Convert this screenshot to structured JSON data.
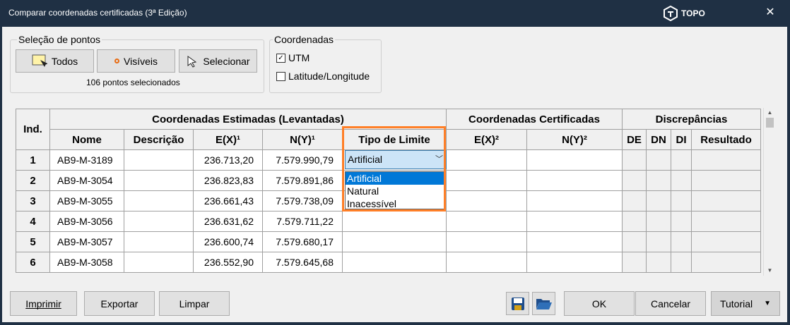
{
  "window": {
    "title": "Comparar coordenadas certificadas (3ª Edição)",
    "brand": "TOPO"
  },
  "selection": {
    "group_label": "Seleção de pontos",
    "todos": "Todos",
    "visiveis": "Visíveis",
    "selecionar": "Selecionar",
    "status": "106 pontos selecionados"
  },
  "coords": {
    "group_label": "Coordenadas",
    "utm": "UTM",
    "utm_checked": true,
    "latlon": "Latitude/Longitude",
    "latlon_checked": false
  },
  "grid": {
    "header_idx": "Ind.",
    "group_estimated": "Coordenadas Estimadas (Levantadas)",
    "group_certified": "Coordenadas Certificadas",
    "group_discrep": "Discrepâncias",
    "col_nome": "Nome",
    "col_descricao": "Descrição",
    "col_ex": "E(X)¹",
    "col_ny": "N(Y)¹",
    "col_tipo": "Tipo de Limite",
    "col_ex2": "E(X)²",
    "col_ny2": "N(Y)²",
    "col_de": "DE",
    "col_dn": "DN",
    "col_di": "DI",
    "col_resultado": "Resultado",
    "rows": [
      {
        "ind": "1",
        "nome": "AB9-M-3189",
        "ex": "236.713,20",
        "ny": "7.579.990,79"
      },
      {
        "ind": "2",
        "nome": "AB9-M-3054",
        "ex": "236.823,83",
        "ny": "7.579.891,86"
      },
      {
        "ind": "3",
        "nome": "AB9-M-3055",
        "ex": "236.661,43",
        "ny": "7.579.738,09"
      },
      {
        "ind": "4",
        "nome": "AB9-M-3056",
        "ex": "236.631,62",
        "ny": "7.579.711,22"
      },
      {
        "ind": "5",
        "nome": "AB9-M-3057",
        "ex": "236.600,74",
        "ny": "7.579.680,17"
      },
      {
        "ind": "6",
        "nome": "AB9-M-3058",
        "ex": "236.552,90",
        "ny": "7.579.645,68"
      }
    ]
  },
  "combo": {
    "value": "Artificial",
    "options": [
      "Artificial",
      "Natural",
      "Inacessível"
    ]
  },
  "footer": {
    "imprimir": "Imprimir",
    "exportar": "Exportar",
    "limpar": "Limpar",
    "ok": "OK",
    "cancelar": "Cancelar",
    "tutorial": "Tutorial"
  },
  "colors": {
    "titlebar": "#1f3044",
    "highlight": "#ff7f27",
    "selection": "#0078d7"
  }
}
